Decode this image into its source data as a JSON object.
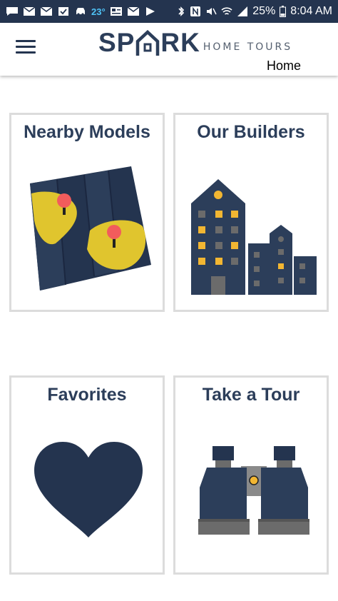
{
  "status_bar": {
    "temperature": "23°",
    "battery": "25%",
    "time": "8:04 AM"
  },
  "app_bar": {
    "brand_letters_left": "SP",
    "brand_letters_right": "RK",
    "brand_subtitle": "HOME TOURS",
    "page_label": "Home"
  },
  "cards": [
    {
      "title": "Nearby Models",
      "icon": "map-icon"
    },
    {
      "title": "Our Builders",
      "icon": "buildings-icon"
    },
    {
      "title": "Favorites",
      "icon": "heart-icon"
    },
    {
      "title": "Take a Tour",
      "icon": "binoculars-icon"
    }
  ],
  "colors": {
    "navy": "#24344f",
    "brand_text": "#2c3e5a",
    "accent_yellow": "#f2b632",
    "pin_red": "#f25c5c",
    "card_border": "#dcdcdc"
  }
}
